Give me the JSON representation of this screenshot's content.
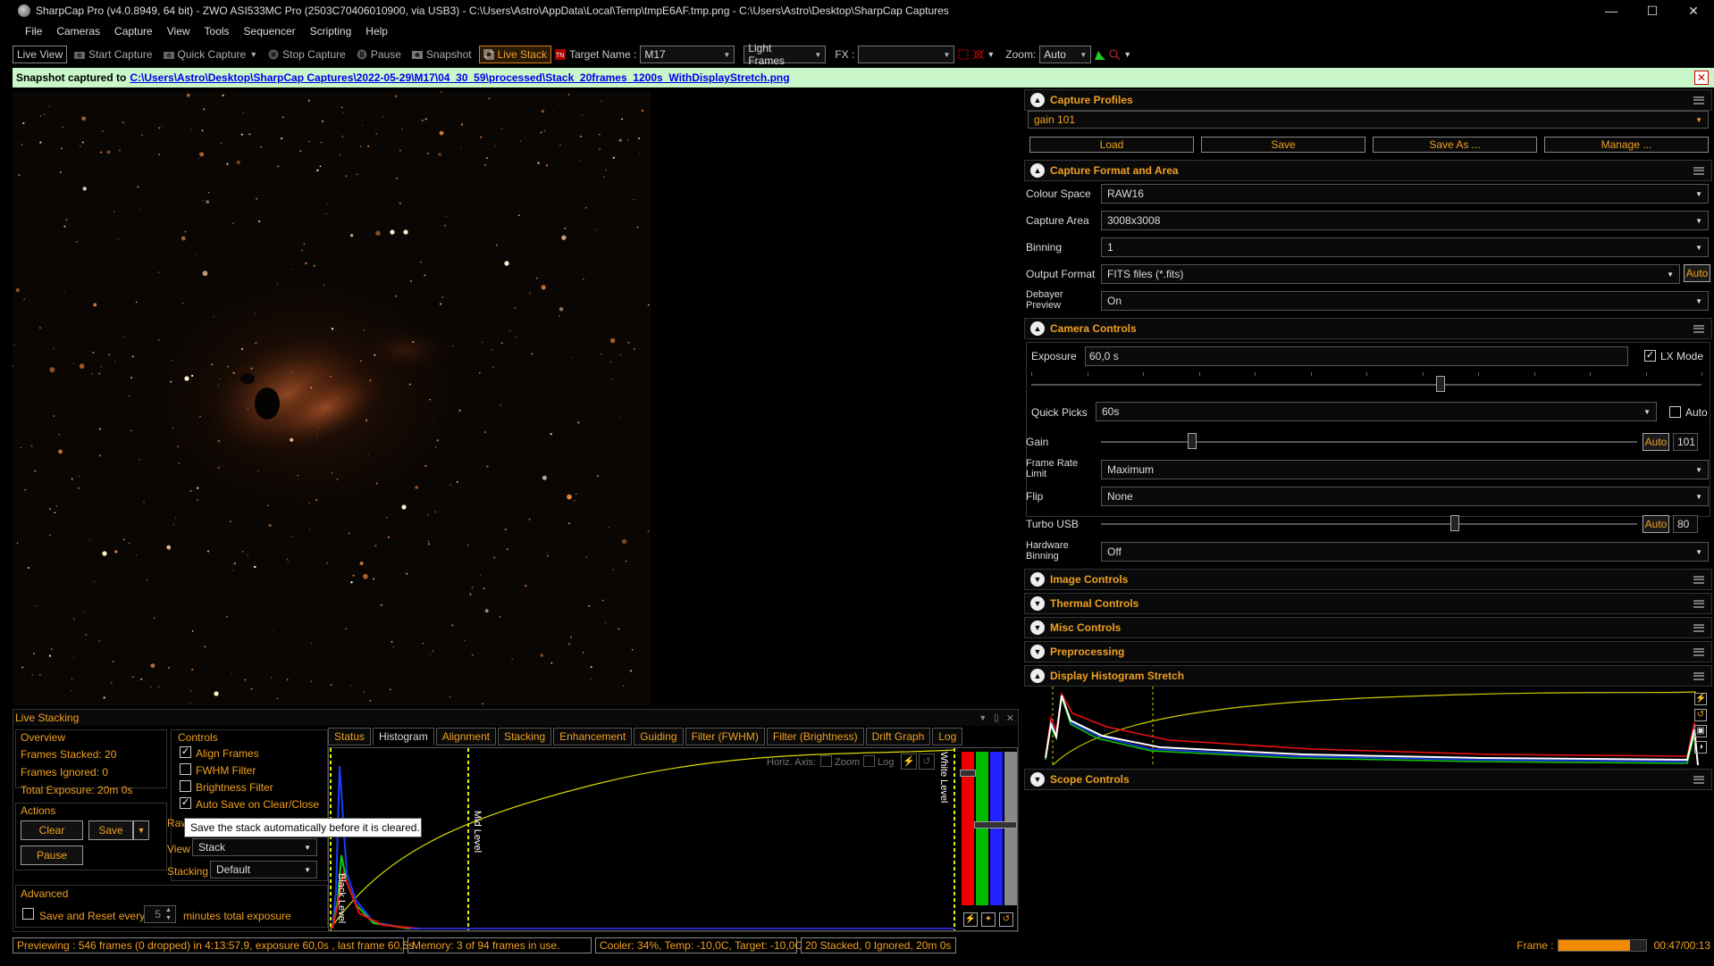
{
  "window": {
    "title": "SharpCap Pro (v4.0.8949, 64 bit) - ZWO ASI533MC Pro (2503C70406010900, via USB3) - C:\\Users\\Astro\\AppData\\Local\\Temp\\tmpE6AF.tmp.png - C:\\Users\\Astro\\Desktop\\SharpCap Captures"
  },
  "menu": [
    "File",
    "Cameras",
    "Capture",
    "View",
    "Tools",
    "Sequencer",
    "Scripting",
    "Help"
  ],
  "toolbar": {
    "live_view": "Live View",
    "start_capture": "Start Capture",
    "quick_capture": "Quick Capture",
    "stop_capture": "Stop Capture",
    "pause": "Pause",
    "snapshot": "Snapshot",
    "live_stack": "Live Stack",
    "target_label": "Target Name :",
    "target_value": "M17",
    "frame_type": "Light Frames",
    "fx_label": "FX :",
    "fx_value": "",
    "zoom_label": "Zoom:",
    "zoom_value": "Auto"
  },
  "snapshot_bar": {
    "prefix": "Snapshot captured to",
    "path_base": "C:\\Users\\Astro\\Desktop\\SharpCap Captures\\2022-05-29\\M17\\04_30_59\\processed\\",
    "path_file": "Stack_20frames_1200s_WithDisplayStretch.png"
  },
  "right_panel": {
    "capture_profiles": {
      "title": "Capture Profiles",
      "profile": "gain 101",
      "buttons": [
        "Load",
        "Save",
        "Save As ...",
        "Manage ..."
      ]
    },
    "capture_format": {
      "title": "Capture Format and Area",
      "colour_space_label": "Colour Space",
      "colour_space": "RAW16",
      "capture_area_label": "Capture Area",
      "capture_area": "3008x3008",
      "binning_label": "Binning",
      "binning": "1",
      "output_format_label": "Output Format",
      "output_format": "FITS files (*.fits)",
      "output_auto": "Auto",
      "debayer_label_1": "Debayer",
      "debayer_label_2": "Preview",
      "debayer": "On"
    },
    "camera_controls": {
      "title": "Camera Controls",
      "exposure_label": "Exposure",
      "exposure": "60,0 s",
      "lx_mode": "LX Mode",
      "exposure_slider": 0.61,
      "quick_picks_label": "Quick Picks",
      "quick_picks": "60s",
      "quick_auto": "Auto",
      "gain_label": "Gain",
      "gain_auto": "Auto",
      "gain": "101",
      "gain_slider": 0.17,
      "frame_rate_label_1": "Frame Rate",
      "frame_rate_label_2": "Limit",
      "frame_rate": "Maximum",
      "flip_label": "Flip",
      "flip": "None",
      "turbo_label": "Turbo USB",
      "turbo_auto": "Auto",
      "turbo": "80",
      "turbo_slider": 0.66,
      "hw_bin_label_1": "Hardware",
      "hw_bin_label_2": "Binning",
      "hw_bin": "Off"
    },
    "collapsed_sections": [
      "Image Controls",
      "Thermal Controls",
      "Misc Controls",
      "Preprocessing"
    ],
    "display_histogram": {
      "title": "Display Histogram Stretch"
    },
    "scope_controls": {
      "title": "Scope Controls"
    }
  },
  "live_stacking": {
    "title": "Live Stacking",
    "overview_title": "Overview",
    "frames_stacked": "Frames Stacked: 20",
    "frames_ignored": "Frames Ignored: 0",
    "total_exposure": "Total Exposure:  20m 0s",
    "actions_title": "Actions",
    "clear": "Clear",
    "save": "Save",
    "pause": "Pause",
    "advanced_title": "Advanced",
    "save_reset": "Save and Reset every",
    "save_reset_value": "5",
    "save_reset_suffix": "minutes total exposure",
    "controls_title": "Controls",
    "align_frames": "Align Frames",
    "fwhm_filter": "FWHM Filter",
    "brightness_filter": "Brightness Filter",
    "auto_save": "Auto Save on Clear/Close",
    "raw_label": "Raw",
    "view_label": "View",
    "view_value": "Stack",
    "stacking_label": "Stacking",
    "stacking_value": "Default",
    "tooltip": "Save the stack automatically before it is cleared.",
    "tabs": [
      "Status",
      "Histogram",
      "Alignment",
      "Stacking",
      "Enhancement",
      "Guiding",
      "Filter (FWHM)",
      "Filter (Brightness)",
      "Drift Graph",
      "Log"
    ],
    "hist_horiz_axis": "Horiz. Axis:",
    "hist_zoom": "Zoom",
    "hist_log": "Log",
    "black_level": "Black Level",
    "mid_level": "Mid Level",
    "white_level": "White Level"
  },
  "status_bar": {
    "previewing": "Previewing : 546 frames (0 dropped) in 4:13:57,9, exposure 60,0s , last frame 60,5s",
    "memory": "Memory: 3 of 94 frames in use.",
    "cooler": "Cooler: 34%, Temp: -10,0C, Target: -10,0C",
    "stacked": "20 Stacked, 0 Ignored, 20m 0s",
    "frame_label": "Frame :",
    "frame_progress": 0.82,
    "time": "00:47/00:13"
  },
  "colors": {
    "accent": "#f0a020",
    "snapshot_bg": "#c9f7c9",
    "nebula": "#c45a1a"
  }
}
